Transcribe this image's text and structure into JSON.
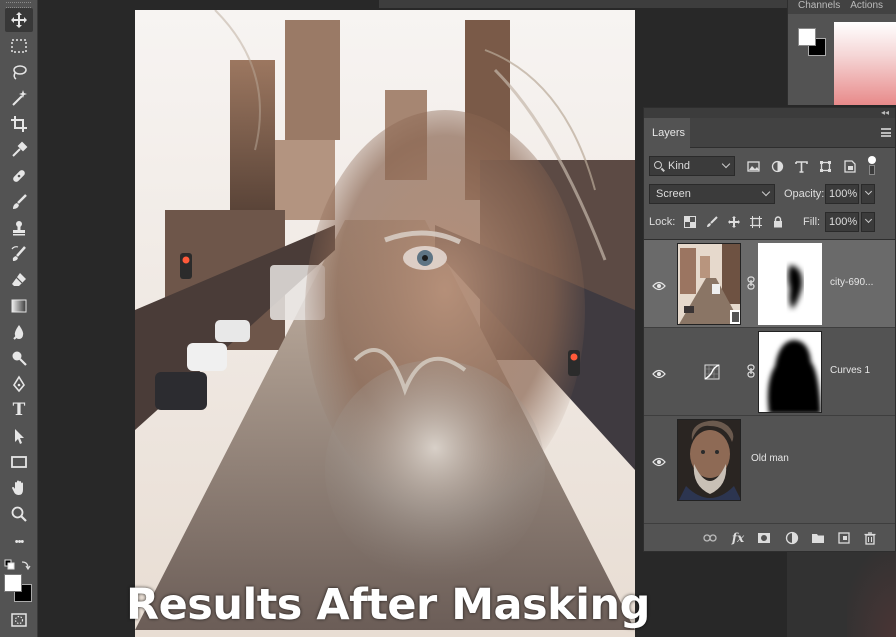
{
  "toolbar": {
    "tools": [
      "move-tool",
      "rectangular-marquee-tool",
      "lasso-tool",
      "magic-wand-tool",
      "crop-tool",
      "eyedropper-tool",
      "spot-healing-brush-tool",
      "brush-tool",
      "clone-stamp-tool",
      "history-brush-tool",
      "eraser-tool",
      "gradient-tool",
      "blur-tool",
      "dodge-tool",
      "pen-tool",
      "type-tool",
      "path-selection-tool",
      "rectangle-tool",
      "hand-tool",
      "zoom-tool",
      "edit-toolbar-more"
    ],
    "type_glyph": "T",
    "more_glyph": "•••",
    "foreground_color": "#ffffff",
    "background_color": "#000000"
  },
  "color_panel": {
    "tabs": [
      "Channels",
      "Actions"
    ]
  },
  "document": {
    "caption": "Results After Masking"
  },
  "layers_panel": {
    "tab_label": "Layers",
    "filter": {
      "kind_label": "Kind"
    },
    "blend_mode": "Screen",
    "opacity_label": "Opacity:",
    "opacity_value": "100%",
    "lock_label": "Lock:",
    "fill_label": "Fill:",
    "fill_value": "100%",
    "layers": [
      {
        "name": "city-690...",
        "visible": true,
        "selected": true,
        "has_mask": true,
        "type": "pixel"
      },
      {
        "name": "Curves 1",
        "visible": true,
        "selected": false,
        "has_mask": true,
        "type": "adjustment"
      },
      {
        "name": "Old man",
        "visible": true,
        "selected": false,
        "has_mask": false,
        "type": "pixel"
      }
    ],
    "bottom_icons": [
      "link-layers-icon",
      "fx-icon",
      "add-mask-icon",
      "adjustment-layer-icon",
      "group-folder-icon",
      "new-layer-icon",
      "delete-icon"
    ],
    "fx_label": "fx"
  }
}
